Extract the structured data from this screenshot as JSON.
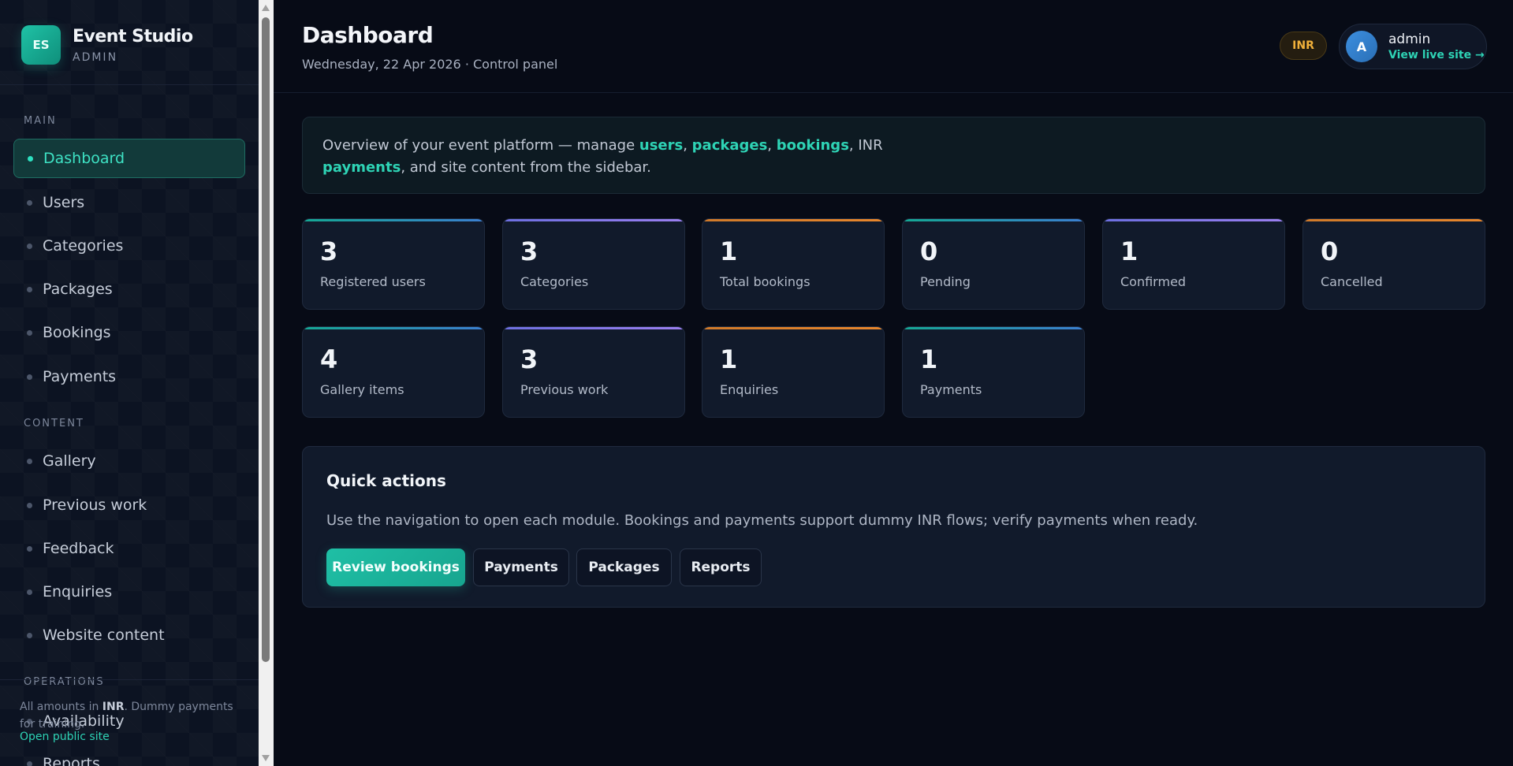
{
  "brand": {
    "logo": "ES",
    "name": "Event Studio",
    "sub": "ADMIN"
  },
  "sidebar": {
    "sections": [
      {
        "label": "MAIN",
        "items": [
          "Dashboard",
          "Users",
          "Categories",
          "Packages",
          "Bookings",
          "Payments"
        ]
      },
      {
        "label": "CONTENT",
        "items": [
          "Gallery",
          "Previous work",
          "Feedback",
          "Enquiries",
          "Website content"
        ]
      },
      {
        "label": "OPERATIONS",
        "items": [
          "Availability",
          "Reports"
        ]
      }
    ],
    "active": "Dashboard",
    "footer": {
      "note_prefix": "All amounts in ",
      "note_bold": "INR",
      "note_suffix": ". Dummy payments for training.",
      "link": "Open public site"
    }
  },
  "header": {
    "title": "Dashboard",
    "subtitle": "Wednesday, 22 Apr 2026 · Control panel",
    "currency": "INR",
    "user": {
      "initial": "A",
      "name": "admin",
      "link": "View live site →"
    }
  },
  "banner": {
    "t1": "Overview of your event platform — manage ",
    "h1": "users",
    "t2": ", ",
    "h2": "packages",
    "t3": ", ",
    "h3": "bookings",
    "t4": ", INR ",
    "h4": "payments",
    "t5": ", and site content from the sidebar."
  },
  "stats": [
    {
      "value": "3",
      "label": "Registered users"
    },
    {
      "value": "3",
      "label": "Categories"
    },
    {
      "value": "1",
      "label": "Total bookings"
    },
    {
      "value": "0",
      "label": "Pending"
    },
    {
      "value": "1",
      "label": "Confirmed"
    },
    {
      "value": "0",
      "label": "Cancelled"
    },
    {
      "value": "4",
      "label": "Gallery items"
    },
    {
      "value": "3",
      "label": "Previous work"
    },
    {
      "value": "1",
      "label": "Enquiries"
    },
    {
      "value": "1",
      "label": "Payments"
    }
  ],
  "quick_actions": {
    "title": "Quick actions",
    "text": "Use the navigation to open each module. Bookings and payments support dummy INR flows; verify payments when ready.",
    "buttons": [
      "Review bookings",
      "Payments",
      "Packages",
      "Reports"
    ]
  },
  "colors": {
    "accent": "#2ed3b5",
    "teal": "#1fc2a6",
    "purple": "#8b7ff0",
    "orange": "#e8862c",
    "gold": "#f0b03a"
  }
}
